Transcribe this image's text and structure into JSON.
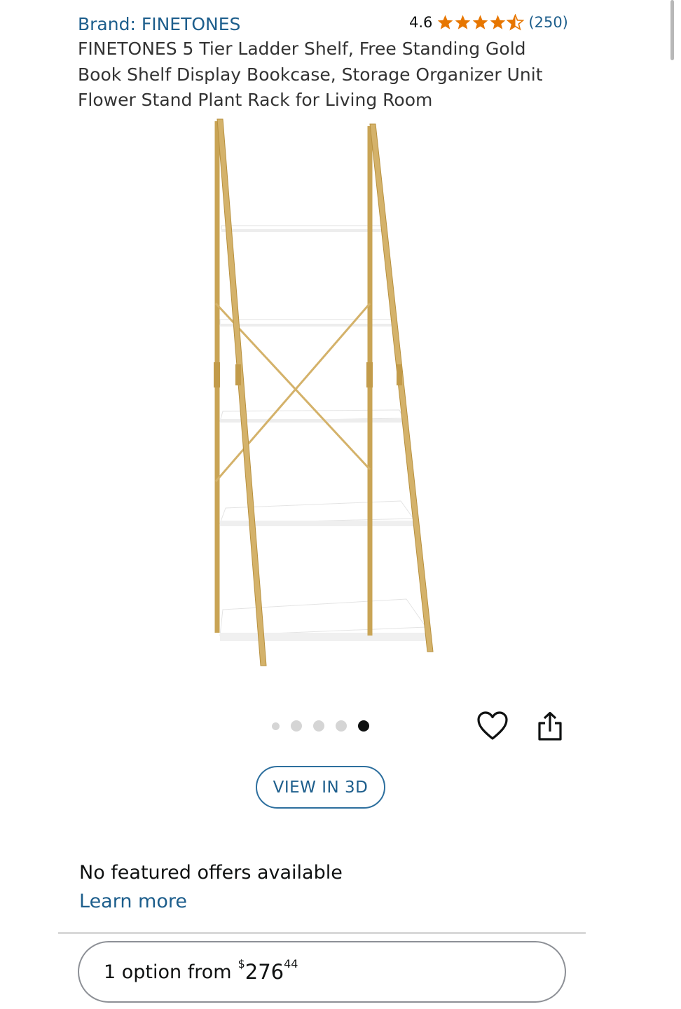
{
  "product": {
    "brand_label": "Brand: FINETONES",
    "title": "FINETONES 5 Tier Ladder Shelf, Free Standing Gold Book Shelf Display Bookcase, Storage Organizer Unit Flower Stand Plant Rack for Living Room"
  },
  "rating": {
    "score": "4.6",
    "stars": 4.6,
    "count": "(250)",
    "star_color": "#e77600"
  },
  "gallery": {
    "image_count": 5,
    "active_index": 4,
    "image_alt_icon": "ladder-shelf-image",
    "shelf_color": "#ffffff",
    "frame_color": "#d4b26a"
  },
  "actions": {
    "favorite_icon": "heart-icon",
    "share_icon": "share-icon",
    "view_3d_label": "VIEW IN 3D"
  },
  "offers": {
    "message": "No featured offers available",
    "learn_more_label": "Learn more"
  },
  "option": {
    "label": "1 option from",
    "currency": "$",
    "price_whole": "276",
    "price_fraction": "44"
  },
  "colors": {
    "link": "#1d5e8c",
    "text": "#0f1111"
  }
}
